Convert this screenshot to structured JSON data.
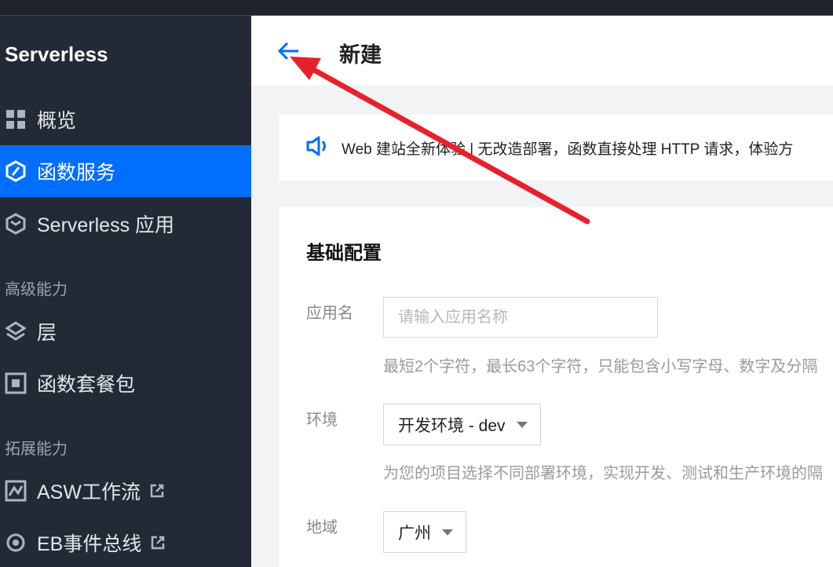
{
  "sidebar": {
    "brand": "Serverless",
    "items": [
      {
        "label": "概览"
      },
      {
        "label": "函数服务"
      },
      {
        "label": "Serverless 应用"
      }
    ],
    "group_advanced": "高级能力",
    "advanced_items": [
      {
        "label": "层"
      },
      {
        "label": "函数套餐包"
      }
    ],
    "group_extension": "拓展能力",
    "extension_items": [
      {
        "label": "ASW工作流"
      },
      {
        "label": "EB事件总线"
      }
    ]
  },
  "header": {
    "title": "新建"
  },
  "notice": {
    "text": "Web 建站全新体验 | 无改造部署，函数直接处理 HTTP 请求，体验方"
  },
  "form": {
    "section_title": "基础配置",
    "app_name_label": "应用名",
    "app_name_placeholder": "请输入应用名称",
    "app_name_hint": "最短2个字符，最长63个字符，只能包含小写字母、数字及分隔",
    "env_label": "环境",
    "env_value": "开发环境 - dev",
    "env_hint": "为您的项目选择不同部署环境，实现开发、测试和生产环境的隔",
    "region_label": "地域",
    "region_value": "广州"
  },
  "colors": {
    "sidebar_bg": "#232a36",
    "active_bg": "#006eff",
    "accent": "#006eff",
    "annotation_arrow": "#e8202b"
  }
}
